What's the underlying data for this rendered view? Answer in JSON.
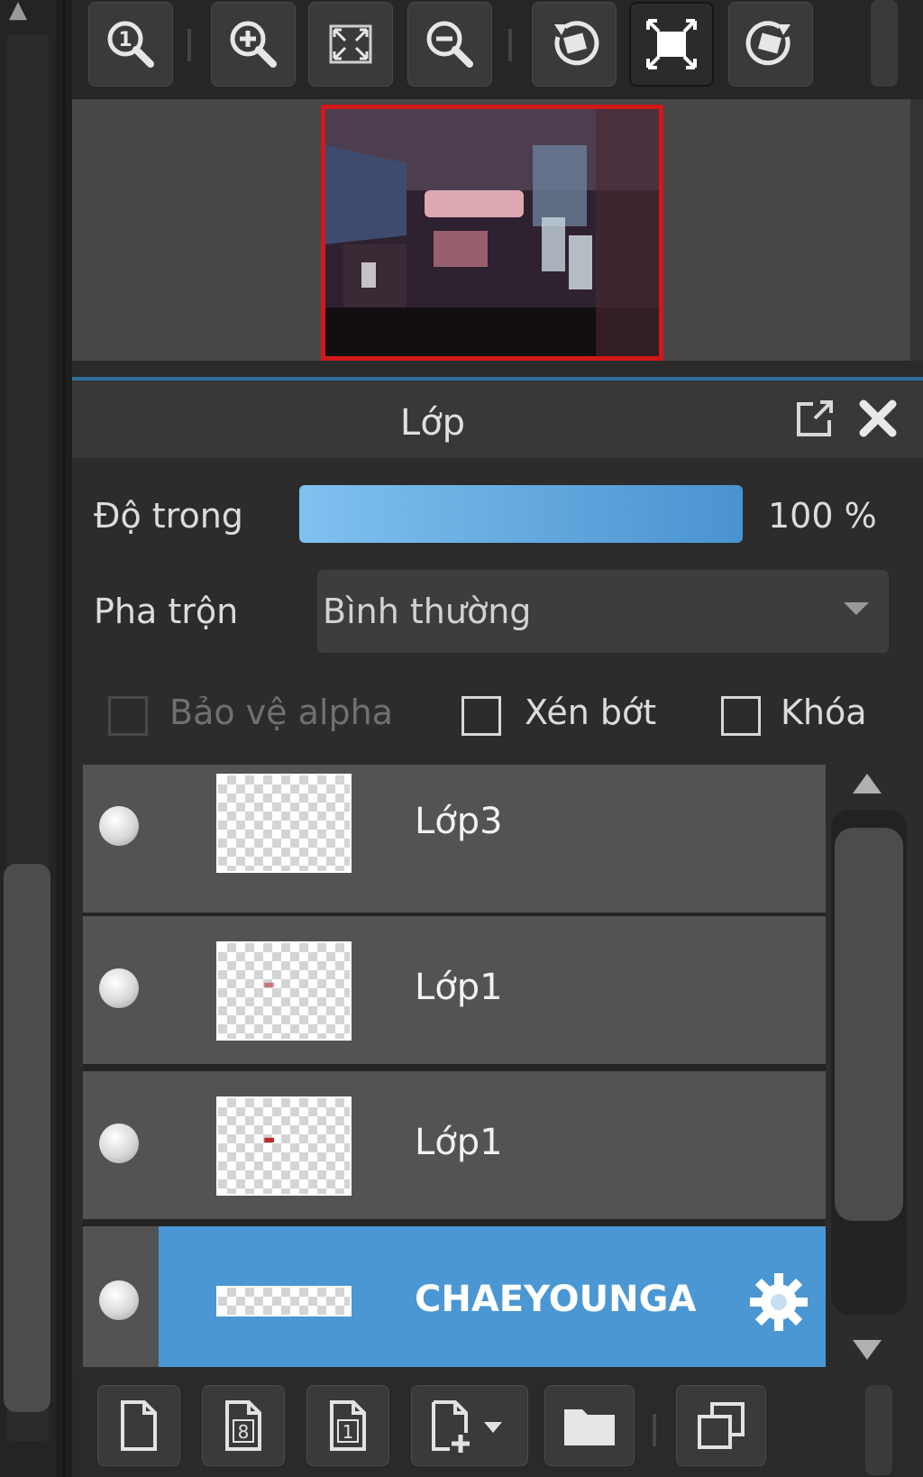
{
  "navigator": {
    "toolbar": [
      {
        "name": "zoom-actual-size-button",
        "icon": "zoom-1-icon"
      },
      {
        "name": "zoom-in-button",
        "icon": "zoom-in-icon"
      },
      {
        "name": "fit-to-window-button",
        "icon": "fit-window-icon"
      },
      {
        "name": "zoom-out-button",
        "icon": "zoom-out-icon"
      },
      {
        "name": "rotate-left-button",
        "icon": "rotate-left-icon"
      },
      {
        "name": "flip-canvas-button",
        "icon": "expand-icon"
      },
      {
        "name": "rotate-right-button",
        "icon": "rotate-right-icon"
      }
    ]
  },
  "layer_panel": {
    "title": "Lớp",
    "opacity": {
      "label": "Độ trong",
      "value_text": "100 %",
      "value": 1.0
    },
    "blend": {
      "label": "Pha trộn",
      "value": "Bình thường"
    },
    "checkboxes": {
      "protect_alpha": {
        "label": "Bảo vệ alpha",
        "checked": false,
        "enabled": false
      },
      "clipping": {
        "label": "Xén bớt",
        "checked": false,
        "enabled": true
      },
      "lock": {
        "label": "Khóa",
        "checked": false,
        "enabled": true
      }
    },
    "layers": [
      {
        "name": "Lớp3",
        "selected": false
      },
      {
        "name": "Lớp1",
        "selected": false
      },
      {
        "name": "Lớp1",
        "selected": false
      },
      {
        "name": "CHAEYOUNGA",
        "selected": true
      }
    ],
    "bottom_toolbar": [
      {
        "name": "new-layer-button",
        "icon": "new-page-icon"
      },
      {
        "name": "new-8bit-layer-button",
        "icon": "page-8-icon",
        "text": "8"
      },
      {
        "name": "new-1bit-layer-button",
        "icon": "page-1-icon",
        "text": "1"
      },
      {
        "name": "add-layer-dropdown-button",
        "icon": "page-add-icon"
      },
      {
        "name": "new-folder-button",
        "icon": "folder-icon"
      },
      {
        "name": "duplicate-layer-button",
        "icon": "duplicate-icon"
      }
    ]
  },
  "colors": {
    "accent": "#4b97d3",
    "navigator_border": "#d21818",
    "panel_bg": "#2c2c2c"
  }
}
